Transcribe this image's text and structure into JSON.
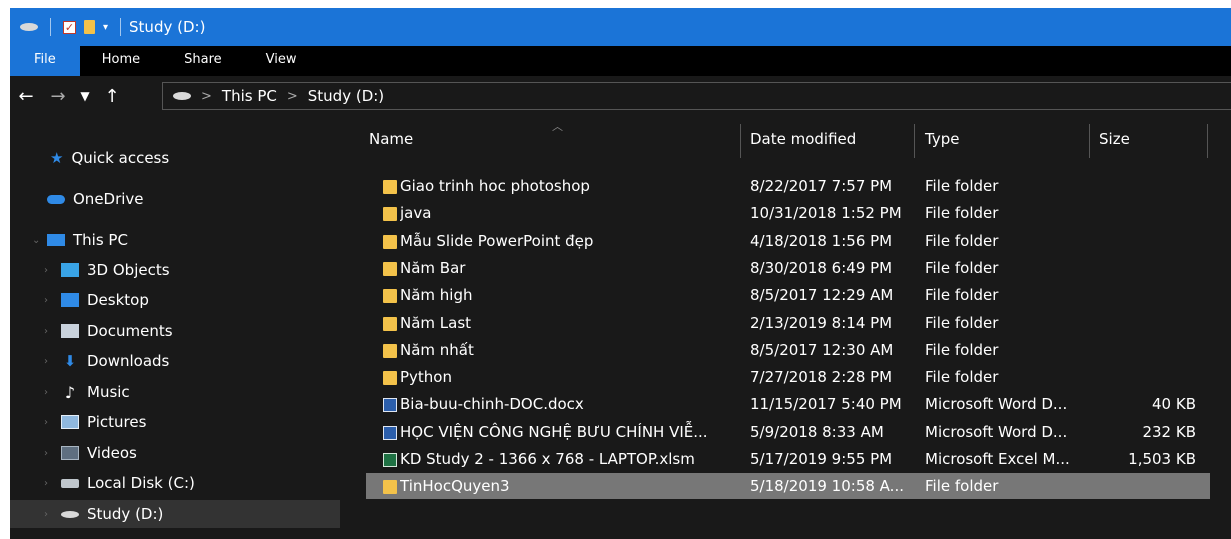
{
  "window": {
    "title": "Study (D:)"
  },
  "ribbon": {
    "tabs": [
      "File",
      "Home",
      "Share",
      "View"
    ]
  },
  "address": {
    "breadcrumbs": [
      "This PC",
      "Study (D:)"
    ]
  },
  "nav": {
    "items": [
      {
        "label": "Quick access",
        "icon": "star-icon"
      },
      {
        "label": "OneDrive",
        "icon": "cloud-icon"
      },
      {
        "label": "This PC",
        "icon": "computer-icon"
      },
      {
        "label": "3D Objects",
        "icon": "cube-icon"
      },
      {
        "label": "Desktop",
        "icon": "desktop-icon"
      },
      {
        "label": "Documents",
        "icon": "document-icon"
      },
      {
        "label": "Downloads",
        "icon": "download-arrow-icon"
      },
      {
        "label": "Music",
        "icon": "music-note-icon"
      },
      {
        "label": "Pictures",
        "icon": "picture-icon"
      },
      {
        "label": "Videos",
        "icon": "film-icon"
      },
      {
        "label": "Local Disk (C:)",
        "icon": "drive-icon"
      },
      {
        "label": "Study (D:)",
        "icon": "drive-icon",
        "selected": true
      }
    ]
  },
  "files": {
    "headers": {
      "name": "Name",
      "date": "Date modified",
      "type": "Type",
      "size": "Size"
    },
    "rows": [
      {
        "name": "Giao trinh hoc photoshop",
        "date": "8/22/2017 7:57 PM",
        "type": "File folder",
        "size": "",
        "icon": "folder-icon"
      },
      {
        "name": "java",
        "date": "10/31/2018 1:52 PM",
        "type": "File folder",
        "size": "",
        "icon": "folder-icon"
      },
      {
        "name": "Mẫu Slide PowerPoint đẹp",
        "date": "4/18/2018 1:56 PM",
        "type": "File folder",
        "size": "",
        "icon": "folder-icon"
      },
      {
        "name": "Năm Bar",
        "date": "8/30/2018 6:49 PM",
        "type": "File folder",
        "size": "",
        "icon": "folder-icon"
      },
      {
        "name": "Năm high",
        "date": "8/5/2017 12:29 AM",
        "type": "File folder",
        "size": "",
        "icon": "folder-icon"
      },
      {
        "name": "Năm Last",
        "date": "2/13/2019 8:14 PM",
        "type": "File folder",
        "size": "",
        "icon": "folder-icon"
      },
      {
        "name": "Năm nhất",
        "date": "8/5/2017 12:30 AM",
        "type": "File folder",
        "size": "",
        "icon": "folder-icon"
      },
      {
        "name": "Python",
        "date": "7/27/2018 2:28 PM",
        "type": "File folder",
        "size": "",
        "icon": "folder-icon"
      },
      {
        "name": "Bia-buu-chinh-DOC.docx",
        "date": "11/15/2017 5:40 PM",
        "type": "Microsoft Word D...",
        "size": "40 KB",
        "icon": "word-doc-icon"
      },
      {
        "name": "HỌC VIỆN CÔNG NGHỆ BƯU CHÍNH VIỄ...",
        "date": "5/9/2018 8:33 AM",
        "type": "Microsoft Word D...",
        "size": "232 KB",
        "icon": "word-doc-icon"
      },
      {
        "name": "KD Study 2 - 1366 x 768 - LAPTOP.xlsm",
        "date": "5/17/2019 9:55 PM",
        "type": "Microsoft Excel M...",
        "size": "1,503 KB",
        "icon": "excel-doc-icon"
      },
      {
        "name": "TinHocQuyen3",
        "date": "5/18/2019 10:58 A...",
        "type": "File folder",
        "size": "",
        "icon": "folder-icon",
        "selected": true
      }
    ]
  }
}
